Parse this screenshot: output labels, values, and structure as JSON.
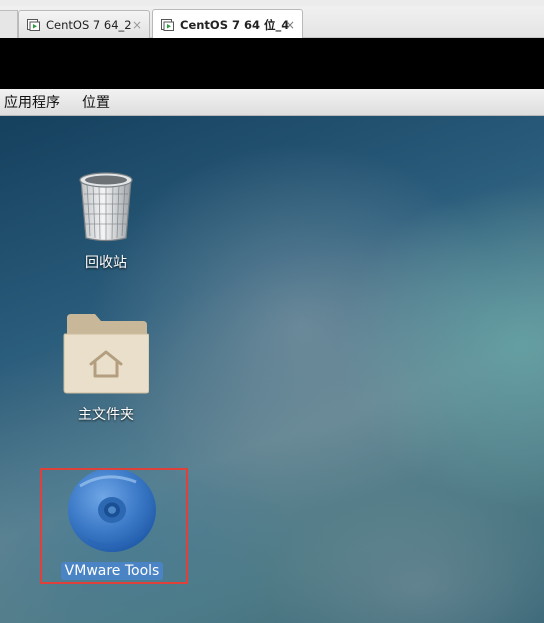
{
  "tabs": [
    {
      "label": "CentOS 7 64_2",
      "close": "×",
      "active": false
    },
    {
      "label": "CentOS 7 64 位_4",
      "close": "×",
      "active": true
    }
  ],
  "menubar": {
    "applications": "应用程序",
    "places": "位置"
  },
  "desktop": {
    "icons": [
      {
        "label": "回收站",
        "icon": "trash-icon"
      },
      {
        "label": "主文件夹",
        "icon": "home-folder-icon"
      },
      {
        "label": "VMware Tools",
        "icon": "cd-disc-icon",
        "selected": true
      }
    ]
  },
  "colors": {
    "selection": "#4a84c4",
    "highlight": "#e0403a",
    "folder": "#e9dcc4"
  }
}
